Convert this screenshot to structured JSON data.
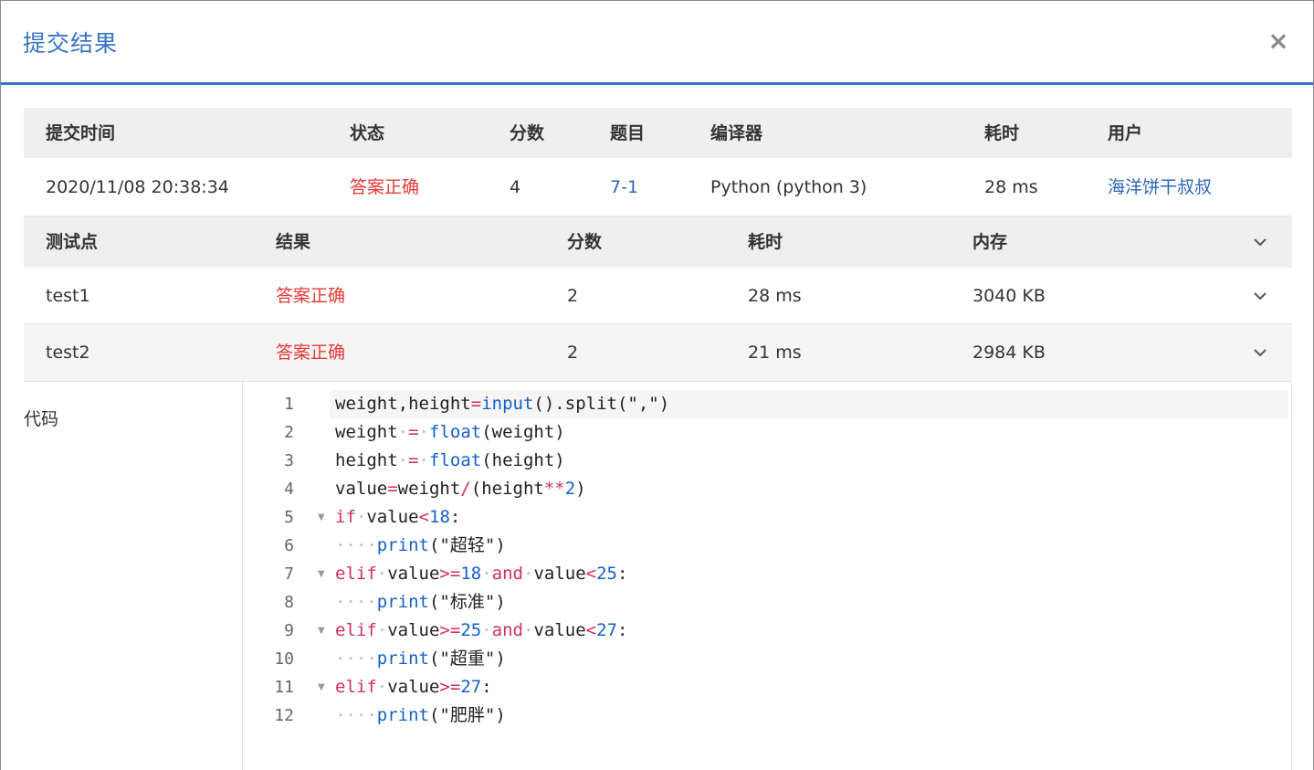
{
  "dialog": {
    "title": "提交结果",
    "close_glyph": "×"
  },
  "summary": {
    "headers": [
      "提交时间",
      "状态",
      "分数",
      "题目",
      "编译器",
      "耗时",
      "用户"
    ],
    "row": {
      "time": "2020/11/08 20:38:34",
      "status": "答案正确",
      "score": "4",
      "problem": "7-1",
      "compiler": "Python (python 3)",
      "elapsed": "28 ms",
      "user": "海洋饼干叔叔"
    }
  },
  "tests": {
    "headers": [
      "测试点",
      "结果",
      "分数",
      "耗时",
      "内存"
    ],
    "rows": [
      {
        "name": "test1",
        "result": "答案正确",
        "score": "2",
        "time": "28 ms",
        "memory": "3040 KB"
      },
      {
        "name": "test2",
        "result": "答案正确",
        "score": "2",
        "time": "21 ms",
        "memory": "2984 KB"
      }
    ]
  },
  "code": {
    "label": "代码",
    "lines": [
      "weight,height=input().split(\",\")",
      "weight = float(weight)",
      "height = float(height)",
      "value=weight/(height**2)",
      "if value<18:",
      "    print(\"超轻\")",
      "elif value>=18 and value<25:",
      "    print(\"标准\")",
      "elif value>=25 and value<27:",
      "    print(\"超重\")",
      "elif value>=27:",
      "    print(\"肥胖\")"
    ],
    "foldable_lines": [
      5,
      7,
      9,
      11
    ]
  },
  "colors": {
    "accent": "#3b73c5",
    "success_red": "#e53935",
    "link": "#2f66b8",
    "header_bg": "#efefef"
  },
  "icons": [
    "close-icon",
    "chevron-down-icon",
    "fold-arrow-icon"
  ]
}
